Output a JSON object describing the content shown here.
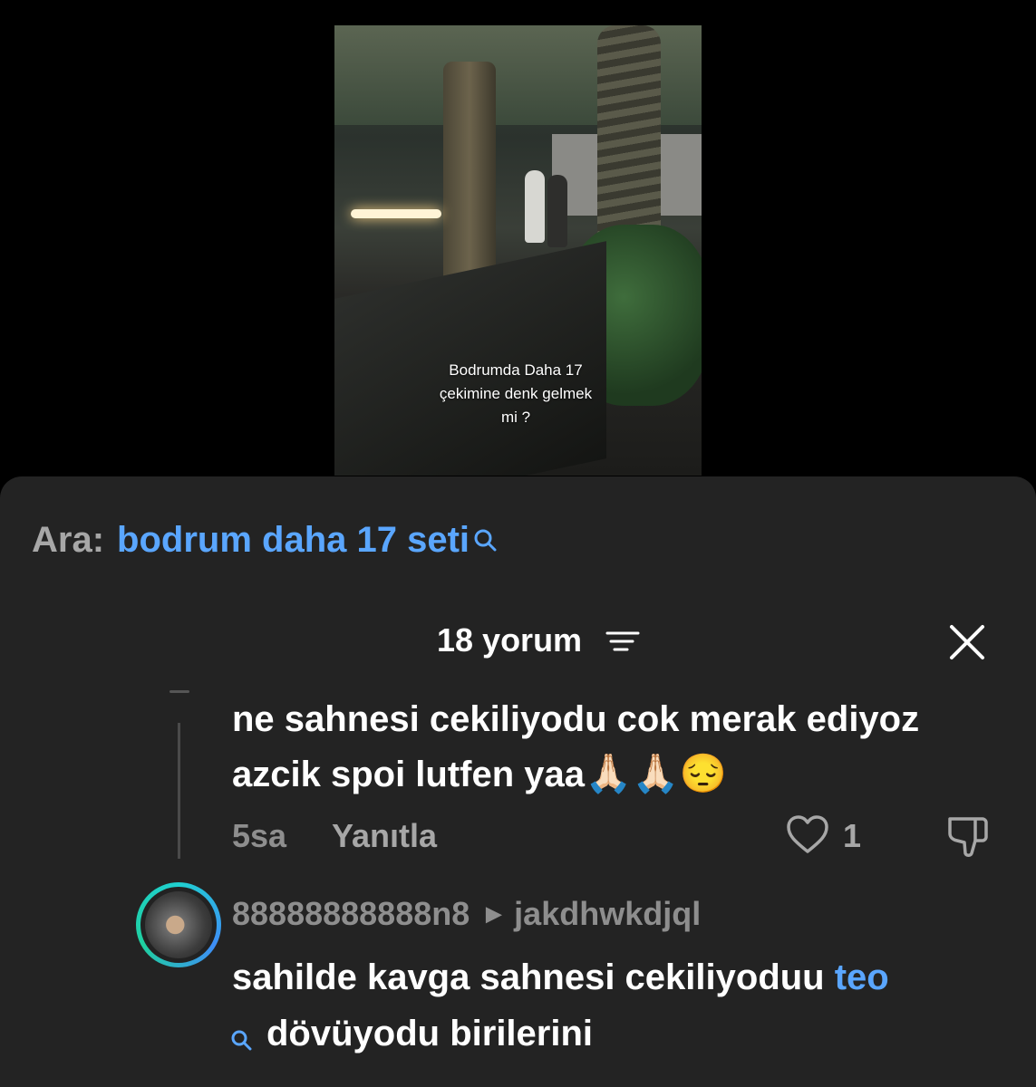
{
  "video": {
    "caption_line1": "Bodrumda Daha 17",
    "caption_line2": "çekimine denk gelmek",
    "caption_line3": "mi ?"
  },
  "search": {
    "prefix": "Ara:",
    "term": "bodrum daha 17 seti",
    "icon": "search-icon",
    "accent_color": "#5aa6ff"
  },
  "comments_header": {
    "title": "18 yorum",
    "sort_icon": "sort-lines-icon",
    "close_icon": "close-icon"
  },
  "comment1": {
    "text": "ne sahnesi cekiliyodu cok merak ediyoz azcik spoi lutfen yaa",
    "emojis": "🙏🏻🙏🏻😔",
    "time": "5sa",
    "reply_label": "Yanıtla",
    "like_count": "1"
  },
  "comment2": {
    "username": "88888888888n8",
    "reply_to": "jakdhwkdjql",
    "text_start": "sahilde kavga sahnesi cekiliyoduu ",
    "mention": "teo",
    "text_end": "dövüyodu birilerini"
  }
}
